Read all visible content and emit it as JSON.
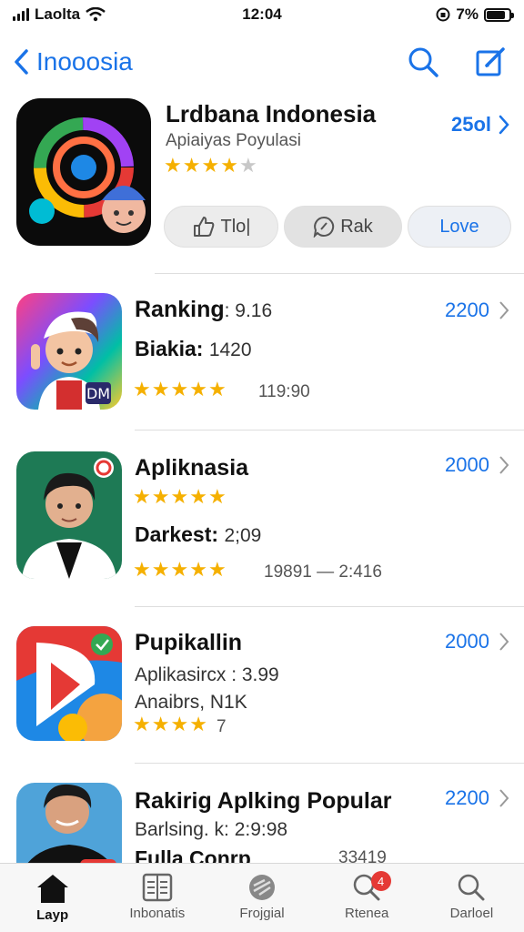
{
  "status_bar": {
    "carrier": "Laolta",
    "time": "12:04",
    "battery": "7%",
    "battery_level": 0.85
  },
  "nav": {
    "back_label": "Inooosia"
  },
  "featured": {
    "title": "Lrdbana Indonesia",
    "subtitle": "Apiaiyas Poyulasi",
    "rating": 4,
    "price": "25ol",
    "actions": [
      {
        "label": "Tlo|",
        "icon": "thumb-up-icon"
      },
      {
        "label": "Rak",
        "icon": "chat-icon"
      },
      {
        "label": "Love",
        "icon": ""
      }
    ]
  },
  "apps": [
    {
      "title": "Ranking",
      "title_suffix": ": 9.16",
      "line2": "Biakia:",
      "line2_value": "1420",
      "rating": 4.5,
      "meta": "119:90",
      "price": "2200",
      "icon": "cartoon-boy-icon"
    },
    {
      "title": "Apliknasia",
      "rating_top": 4.5,
      "line2": "Darkest:",
      "line2_value": "2;09",
      "rating": 4.5,
      "meta": "19891 — 2:416",
      "price": "2000",
      "icon": "man-portrait-icon"
    },
    {
      "title": "Pupikallin",
      "line2": "Aplikasircx : 3.99",
      "line3": "Anaibrs, N1K",
      "rating": 4,
      "meta": "7",
      "price": "2000",
      "icon": "play-logo-icon"
    },
    {
      "title": "Rakirig Aplking Popular",
      "line2": "Barlsing. k: 2:9:98",
      "line3": "Fulla Conrp",
      "meta": "33419",
      "price": "2200",
      "icon": "man-photo-icon"
    }
  ],
  "tabs": [
    {
      "label": "Layp",
      "icon": "home-icon",
      "active": true
    },
    {
      "label": "Inbonatis",
      "icon": "apps-grid-icon",
      "active": false
    },
    {
      "label": "Frojgial",
      "icon": "games-icon",
      "active": false
    },
    {
      "label": "Rtenea",
      "icon": "search-icon",
      "active": false,
      "badge": "4"
    },
    {
      "label": "Darloel",
      "icon": "search-icon",
      "active": false
    }
  ],
  "colors": {
    "accent": "#1a73e8",
    "star": "#f5b000",
    "badge": "#e53935"
  }
}
